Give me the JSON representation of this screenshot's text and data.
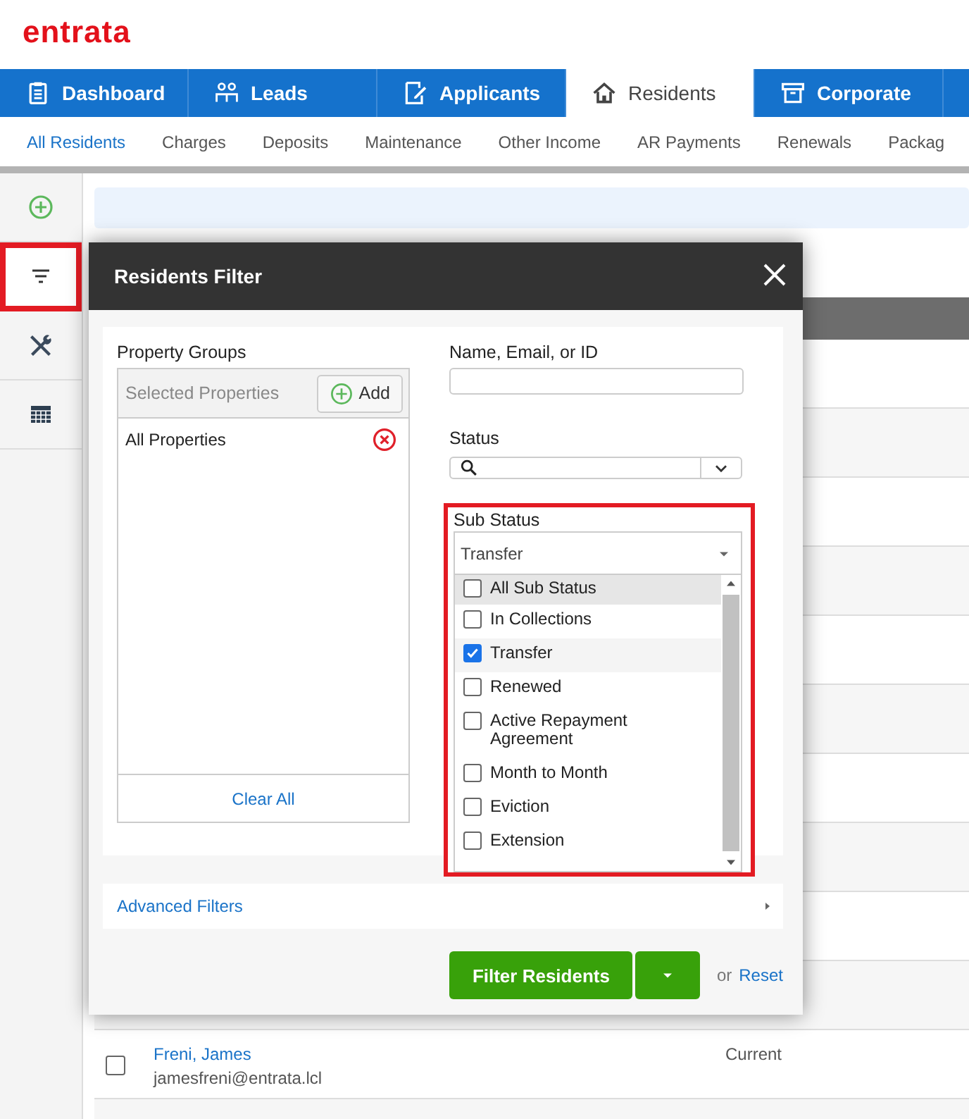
{
  "logo": "entrata",
  "main_nav": [
    {
      "label": "Dashboard",
      "kind": "clipboard",
      "selected": false
    },
    {
      "label": "Leads",
      "kind": "people",
      "selected": false
    },
    {
      "label": "Applicants",
      "kind": "edit",
      "selected": false
    },
    {
      "label": "Residents",
      "kind": "house",
      "selected": true
    },
    {
      "label": "Corporate",
      "kind": "archive",
      "selected": false
    }
  ],
  "sub_nav": [
    {
      "label": "All Residents",
      "selected": true
    },
    {
      "label": "Charges",
      "selected": false
    },
    {
      "label": "Deposits",
      "selected": false
    },
    {
      "label": "Maintenance",
      "selected": false
    },
    {
      "label": "Other Income",
      "selected": false
    },
    {
      "label": "AR Payments",
      "selected": false
    },
    {
      "label": "Renewals",
      "selected": false
    },
    {
      "label": "Packag",
      "selected": false
    }
  ],
  "side_rail": [
    {
      "kind": "add",
      "highlighted": false
    },
    {
      "kind": "filter",
      "highlighted": true
    },
    {
      "kind": "tools",
      "highlighted": false
    },
    {
      "kind": "table",
      "highlighted": false
    }
  ],
  "residents": [
    {
      "name": "Freni, James",
      "email": "jamesfreni@entrata.lcl",
      "status": "Current",
      "checked": false
    }
  ],
  "filter_modal": {
    "title": "Residents Filter",
    "property_groups": {
      "label": "Property Groups",
      "list_header": "Selected Properties",
      "add_button": "Add",
      "items": [
        {
          "label": "All Properties"
        }
      ],
      "clear_button": "Clear All"
    },
    "name_field": {
      "label": "Name, Email, or ID"
    },
    "status_field": {
      "label": "Status"
    },
    "sub_status": {
      "label": "Sub Status",
      "value": "Transfer",
      "highlighted": true,
      "options": [
        {
          "label": "All Sub Status",
          "checked": false,
          "hovered": true
        },
        {
          "label": "In Collections",
          "checked": false,
          "hovered": false
        },
        {
          "label": "Transfer",
          "checked": true,
          "hovered": false
        },
        {
          "label": "Renewed",
          "checked": false,
          "hovered": false
        },
        {
          "label": "Active Repayment Agreement",
          "checked": false,
          "hovered": false
        },
        {
          "label": "Month to Month",
          "checked": false,
          "hovered": false
        },
        {
          "label": "Eviction",
          "checked": false,
          "hovered": false
        },
        {
          "label": "Extension",
          "checked": false,
          "hovered": false
        }
      ]
    },
    "advanced_filters": "Advanced Filters",
    "filter_button": "Filter Residents",
    "or_text": "or",
    "reset_link": "Reset"
  }
}
